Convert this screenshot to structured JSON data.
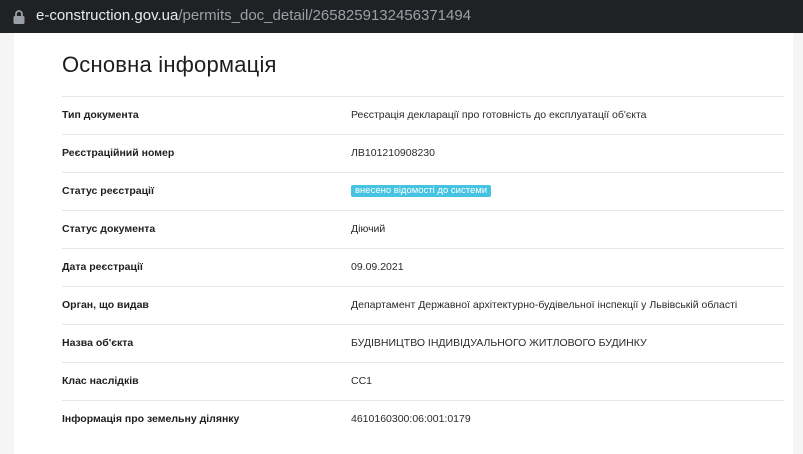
{
  "browser": {
    "url_domain": "e-construction.gov.ua",
    "url_path": "/permits_doc_detail/2658259132456371494"
  },
  "page": {
    "title": "Основна інформація"
  },
  "rows": [
    {
      "label": "Тип документа",
      "value": "Реєстрація декларації про готовність до експлуатації об'єкта"
    },
    {
      "label": "Реєстраційний номер",
      "value": "ЛВ101210908230"
    },
    {
      "label": "Статус реєстрації",
      "value": "внесено відомості до системи",
      "badge_color": "#46c3e0"
    },
    {
      "label": "Статус документа",
      "value": "Діючий"
    },
    {
      "label": "Дата реєстрації",
      "value": "09.09.2021"
    },
    {
      "label": "Орган, що видав",
      "value": "Департамент Державної архітектурно-будівельної інспекції у Львівській області"
    },
    {
      "label": "Назва об'єкта",
      "value": "БУДІВНИЦТВО ІНДИВІДУАЛЬНОГО ЖИТЛОВОГО БУДИНКУ"
    },
    {
      "label": "Клас наслідків",
      "value": "СС1"
    },
    {
      "label": "Інформація про земельну ділянку",
      "value": "4610160300:06:001:0179"
    }
  ],
  "icons": {
    "lock": "lock-icon"
  }
}
